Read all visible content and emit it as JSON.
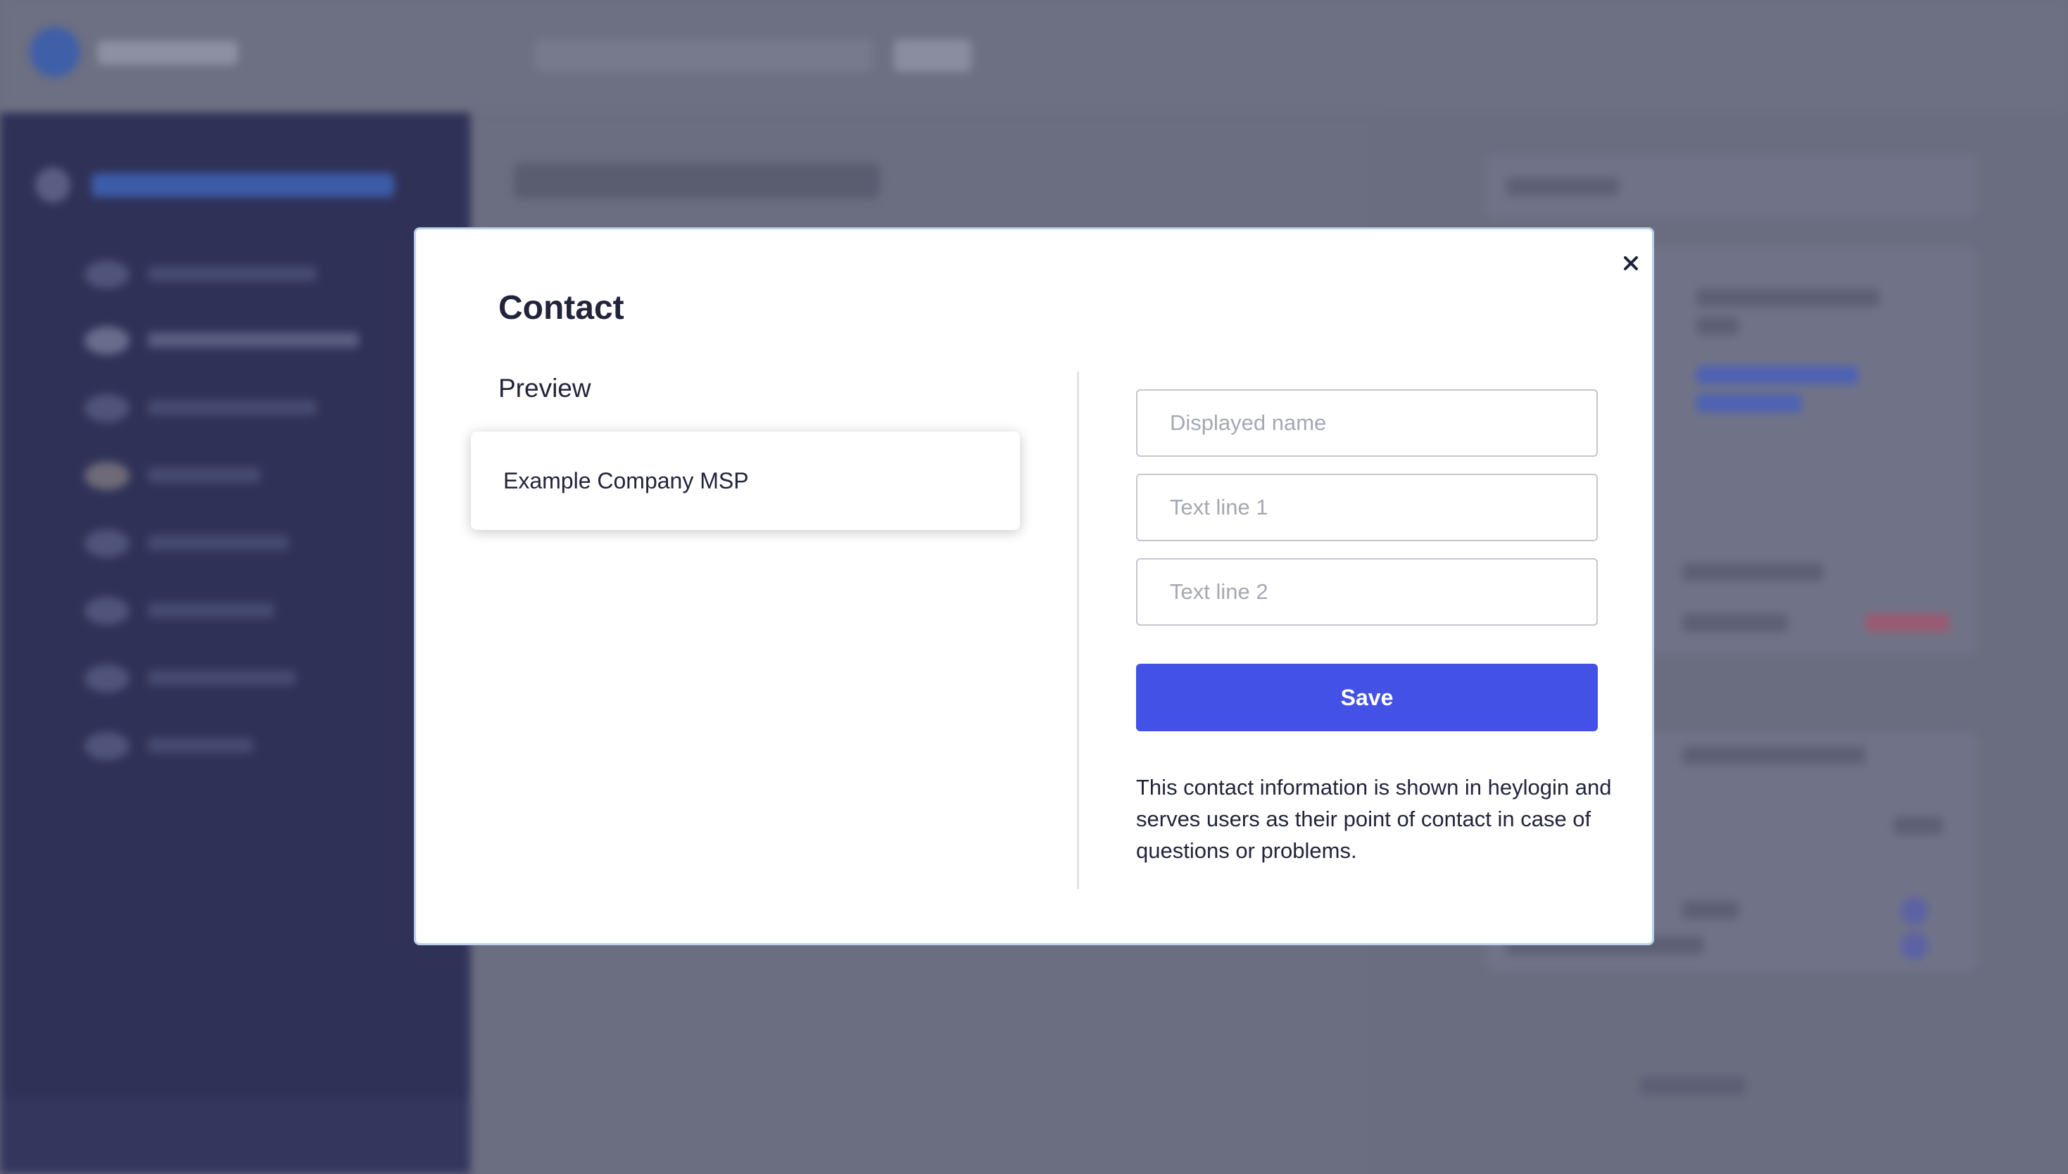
{
  "modal": {
    "title": "Contact",
    "close_label": "×",
    "preview_label": "Preview",
    "preview_company": "Example Company MSP",
    "fields": {
      "displayed_name_placeholder": "Displayed name",
      "text_line_1_placeholder": "Text line 1",
      "text_line_2_placeholder": "Text line 2"
    },
    "save_label": "Save",
    "info_text": "This contact information is shown in heylogin and serves users as their point of contact in case of questions or problems."
  },
  "colors": {
    "accent": "#4451e6",
    "overlay": "#6b6d80",
    "sidebar": "#2f3157",
    "modal_border": "#b9d3ea"
  },
  "icons": {
    "close": "close-icon"
  }
}
